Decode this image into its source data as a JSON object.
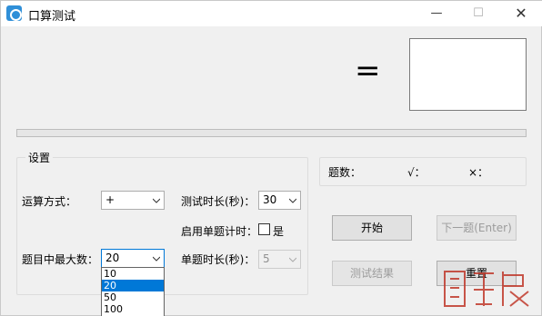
{
  "window": {
    "title": "口算测试",
    "minimize_glyph": "—",
    "maximize_glyph": "☐",
    "close_glyph": "✕"
  },
  "problem": {
    "operator_display": "=",
    "answer": ""
  },
  "progress": {
    "value": 0
  },
  "settings": {
    "group_title": "设置",
    "op_label": "运算方式：",
    "op_value": "+",
    "max_label": "题目中最大数：",
    "max_value": "20",
    "max_options": [
      "10",
      "20",
      "50",
      "100"
    ],
    "max_selected_index": 1,
    "duration_label": "测试时长(秒)：",
    "duration_value": "30",
    "per_question_timer_label": "启用单题计时：",
    "per_question_timer_checked": false,
    "yes_label": "是",
    "per_question_label": "单题时长(秒)：",
    "per_question_value": "5"
  },
  "stats": {
    "count_label": "题数：",
    "correct_label": "√：",
    "wrong_label": "×："
  },
  "buttons": {
    "start": "开始",
    "next": "下一题(Enter)",
    "result": "测试结果",
    "reset": "重置"
  },
  "colors": {
    "accent": "#0078d7",
    "watermark": "#c0392b"
  },
  "icons": {
    "app": "app-icon",
    "dropdown": "chevron-down-icon"
  }
}
